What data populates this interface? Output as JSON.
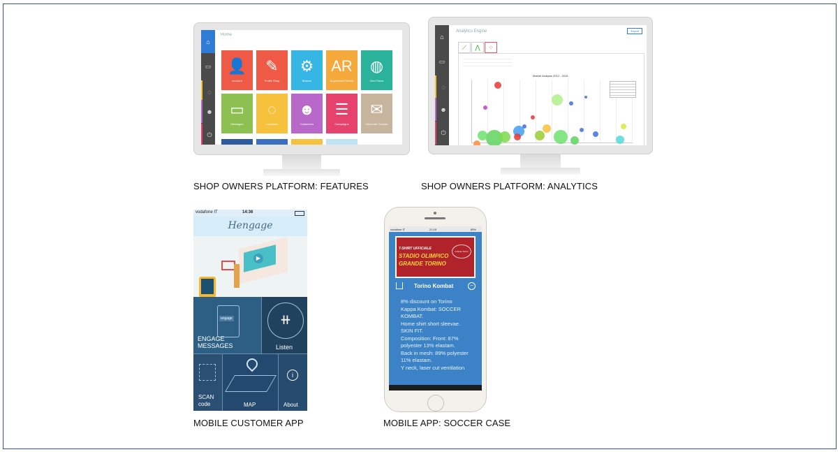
{
  "captions": {
    "features": "SHOP OWNERS PLATFORM: FEATURES",
    "analytics": "SHOP OWNERS PLATFORM: ANALYTICS",
    "customer_app": "MOBILE CUSTOMER APP",
    "soccer_case": "MOBILE APP: SOCCER CASE"
  },
  "features_screen": {
    "breadcrumb": "Home",
    "tiles": [
      {
        "label": "Account",
        "icon": "user-icon",
        "color": "#ee5a45"
      },
      {
        "label": "Profile Shop",
        "icon": "shop-icon",
        "color": "#ee5a45"
      },
      {
        "label": "Beacon",
        "icon": "gears-icon",
        "color": "#35b6e5"
      },
      {
        "label": "Augmented Reality",
        "icon": "ar-icon",
        "color": "#f4a93a"
      },
      {
        "label": "Geo-Fence",
        "icon": "globe-icon",
        "color": "#2ab39a"
      },
      {
        "label": "Messages",
        "icon": "chat-icon",
        "color": "#8cc152"
      },
      {
        "label": "Locations",
        "icon": "map-pin-icon",
        "color": "#f6c13c"
      },
      {
        "label": "Customers",
        "icon": "people-icon",
        "color": "#b868c9"
      },
      {
        "label": "Campaigns",
        "icon": "list-icon",
        "color": "#e5426e"
      },
      {
        "label": "Generate Coupon",
        "icon": "coupon-icon",
        "color": "#c6b49c"
      }
    ]
  },
  "analytics_screen": {
    "title": "Analytics Engine",
    "export_label": "Export",
    "chart_title": "Market Analysis 2012 - 2015"
  },
  "customer_app": {
    "carrier": "vodafone IT",
    "time": "14:36",
    "app_name": "Hengage",
    "menu": {
      "engage": "ENGAGE MESSAGES",
      "engage_badge": "engage",
      "listen": "Listen",
      "scan": "SCAN code",
      "map": "MAP",
      "about": "About"
    }
  },
  "soccer_app": {
    "carrier": "vodafone IT",
    "time": "21:18",
    "battery": "89%",
    "banner_line1": "T-SHIRT UFFICIALE",
    "banner_line2": "STADIO OLIMPICO",
    "banner_line3": "GRANDE TORINO",
    "banner_logo": "Grande Torino",
    "title": "Torino Kombat",
    "body": [
      "8% discount on Torino",
      "Kappa Kombat: SOCCER",
      "KOMBAT.",
      "Home shirt short sleevae.",
      "SKIN FIT.",
      "Composition: Front: 87%",
      "polyester 13% elastam.",
      "Back in mesh: 89% polyester",
      "11% elastam.",
      "Y neck, laser cut ventilation"
    ]
  }
}
